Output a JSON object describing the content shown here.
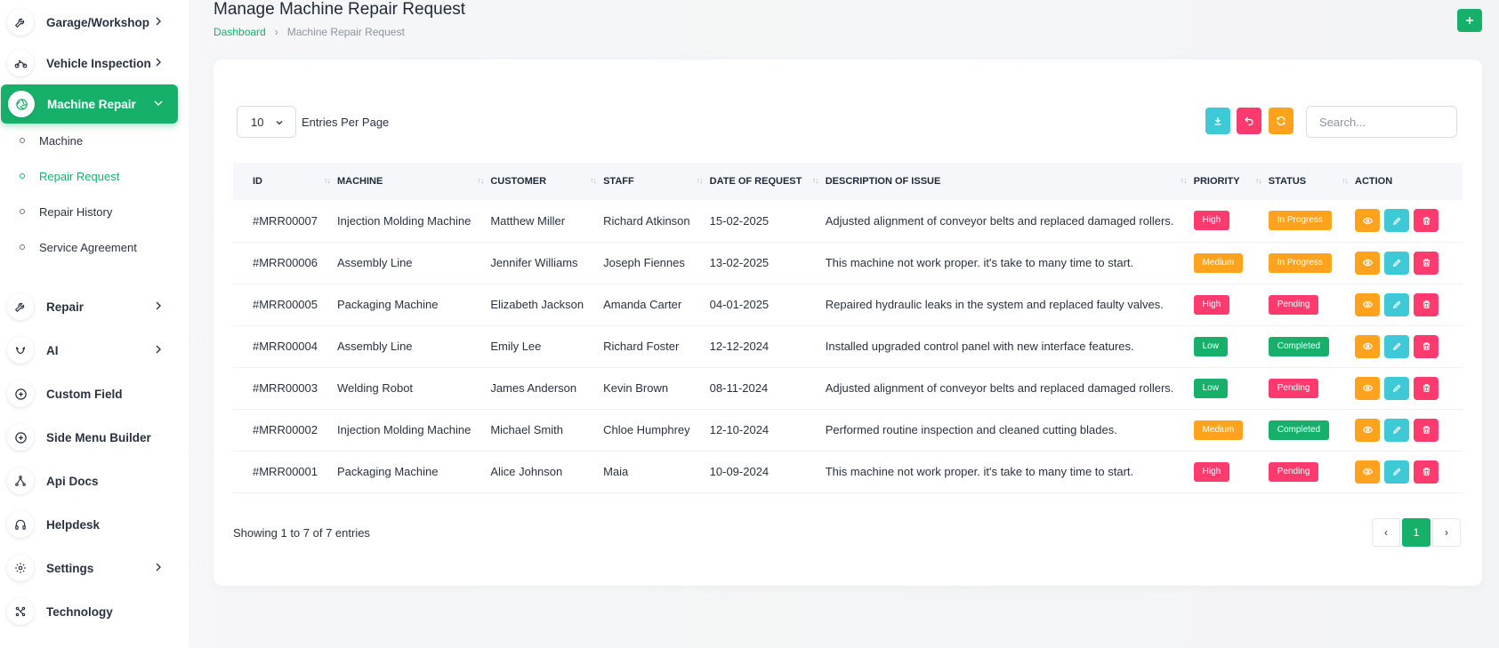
{
  "sidebar": {
    "items": [
      {
        "label": "Garage/Workshop",
        "icon": "wrench-icon",
        "has_chevron": true
      },
      {
        "label": "Vehicle Inspection",
        "icon": "motorcycle-icon",
        "has_chevron": true
      },
      {
        "label": "Machine Repair",
        "icon": "aperture-icon",
        "has_chevron": true,
        "active": true
      },
      {
        "label": "Repair",
        "icon": "tools-icon",
        "has_chevron": true
      },
      {
        "label": "AI",
        "icon": "brain-icon",
        "has_chevron": true
      },
      {
        "label": "Custom Field",
        "icon": "plus-circle-icon",
        "has_chevron": false
      },
      {
        "label": "Side Menu Builder",
        "icon": "plus-circle-icon",
        "has_chevron": false
      },
      {
        "label": "Api Docs",
        "icon": "network-icon",
        "has_chevron": false
      },
      {
        "label": "Helpdesk",
        "icon": "headphones-icon",
        "has_chevron": false
      },
      {
        "label": "Settings",
        "icon": "gear-icon",
        "has_chevron": true
      },
      {
        "label": "Technology",
        "icon": "nodes-icon",
        "has_chevron": false
      }
    ],
    "sub_items": [
      {
        "label": "Machine"
      },
      {
        "label": "Repair Request",
        "active": true
      },
      {
        "label": "Repair History"
      },
      {
        "label": "Service Agreement"
      }
    ]
  },
  "header": {
    "title": "Manage Machine Repair Request",
    "breadcrumb_home": "Dashboard",
    "breadcrumb_sep": "›",
    "breadcrumb_current": "Machine Repair Request"
  },
  "toolbar": {
    "entries_value": "10",
    "entries_label": "Entries Per Page",
    "search_placeholder": "Search..."
  },
  "table": {
    "columns": [
      "ID",
      "MACHINE",
      "CUSTOMER",
      "STAFF",
      "DATE OF REQUEST",
      "DESCRIPTION OF ISSUE",
      "PRIORITY",
      "STATUS",
      "ACTION"
    ],
    "rows": [
      {
        "id": "#MRR00007",
        "machine": "Injection Molding Machine",
        "customer": "Matthew Miller",
        "staff": "Richard Atkinson",
        "date": "15-02-2025",
        "description": "Adjusted alignment of conveyor belts and replaced damaged rollers.",
        "priority": "High",
        "status": "In Progress"
      },
      {
        "id": "#MRR00006",
        "machine": "Assembly Line",
        "customer": "Jennifer Williams",
        "staff": "Joseph Fiennes",
        "date": "13-02-2025",
        "description": "This machine not work proper. it's take to many time to start.",
        "priority": "Medium",
        "status": "In Progress"
      },
      {
        "id": "#MRR00005",
        "machine": "Packaging Machine",
        "customer": "Elizabeth Jackson",
        "staff": "Amanda Carter",
        "date": "04-01-2025",
        "description": "Repaired hydraulic leaks in the system and replaced faulty valves.",
        "priority": "High",
        "status": "Pending"
      },
      {
        "id": "#MRR00004",
        "machine": "Assembly Line",
        "customer": "Emily Lee",
        "staff": "Richard Foster",
        "date": "12-12-2024",
        "description": "Installed upgraded control panel with new interface features.",
        "priority": "Low",
        "status": "Completed"
      },
      {
        "id": "#MRR00003",
        "machine": "Welding Robot",
        "customer": "James Anderson",
        "staff": "Kevin Brown",
        "date": "08-11-2024",
        "description": "Adjusted alignment of conveyor belts and replaced damaged rollers.",
        "priority": "Low",
        "status": "Pending"
      },
      {
        "id": "#MRR00002",
        "machine": "Injection Molding Machine",
        "customer": "Michael Smith",
        "staff": "Chloe Humphrey",
        "date": "12-10-2024",
        "description": "Performed routine inspection and cleaned cutting blades.",
        "priority": "Medium",
        "status": "Completed"
      },
      {
        "id": "#MRR00001",
        "machine": "Packaging Machine",
        "customer": "Alice Johnson",
        "staff": "Maia",
        "date": "10-09-2024",
        "description": "This machine not work proper. it's take to many time to start.",
        "priority": "High",
        "status": "Pending"
      }
    ]
  },
  "footer": {
    "showing_text": "Showing 1 to 7 of 7 entries",
    "prev": "‹",
    "current_page": "1",
    "next": "›"
  },
  "colors": {
    "primary": "#16b06a",
    "high": "#ff3a6e",
    "medium": "#ffa21d",
    "low": "#16b06a",
    "in_progress": "#ffa21d",
    "pending": "#ff3a6e",
    "completed": "#16b06a",
    "info": "#3ec9d6"
  }
}
